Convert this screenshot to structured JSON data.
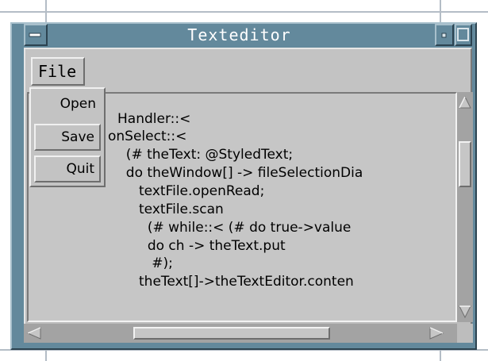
{
  "window": {
    "title": "Texteditor",
    "colors": {
      "titlebar": "#63899c",
      "client": "#bdbdbd",
      "title_text": "#ffffff"
    }
  },
  "menubar": {
    "file_label": "File"
  },
  "file_menu": {
    "items": [
      {
        "label": "Open",
        "state": "normal"
      },
      {
        "label": "Save",
        "state": "highlighted"
      },
      {
        "label": "Quit",
        "state": "highlighted"
      }
    ]
  },
  "editor": {
    "lines": [
      "Handler::<",
      "onSelect::<",
      "  (# theText: @StyledText;",
      "  do theWindow[] -> fileSelectionDia",
      "     textFile.openRead;",
      "     textFile.scan",
      "       (# while::< (# do true->value",
      "       do ch -> theText.put",
      "        #);",
      "     theText[]->theTextEditor.conten"
    ]
  },
  "icons": {
    "window_menu": "window-menu-icon",
    "minimize": "minimize-icon",
    "maximize": "maximize-icon",
    "scroll_up": "arrow-up-icon",
    "scroll_down": "arrow-down-icon",
    "scroll_left": "arrow-left-icon",
    "scroll_right": "arrow-right-icon"
  }
}
